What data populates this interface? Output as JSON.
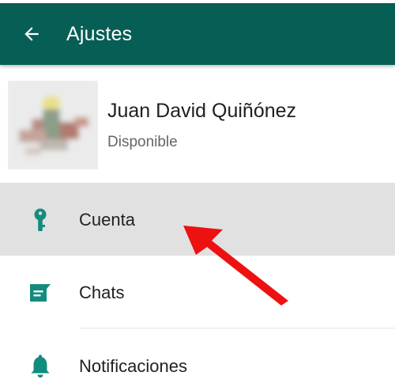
{
  "appbar": {
    "title": "Ajustes",
    "back_icon": "arrow-left-icon",
    "background": "#075e54"
  },
  "profile": {
    "name": "Juan David Quiñónez",
    "status": "Disponible"
  },
  "menu": [
    {
      "label": "Cuenta",
      "icon": "key-icon",
      "highlighted": true
    },
    {
      "label": "Chats",
      "icon": "chat-icon",
      "highlighted": false
    },
    {
      "label": "Notificaciones",
      "icon": "bell-icon",
      "highlighted": false
    }
  ],
  "colors": {
    "accent": "#128c7e",
    "annotation_arrow": "#ee1111"
  }
}
